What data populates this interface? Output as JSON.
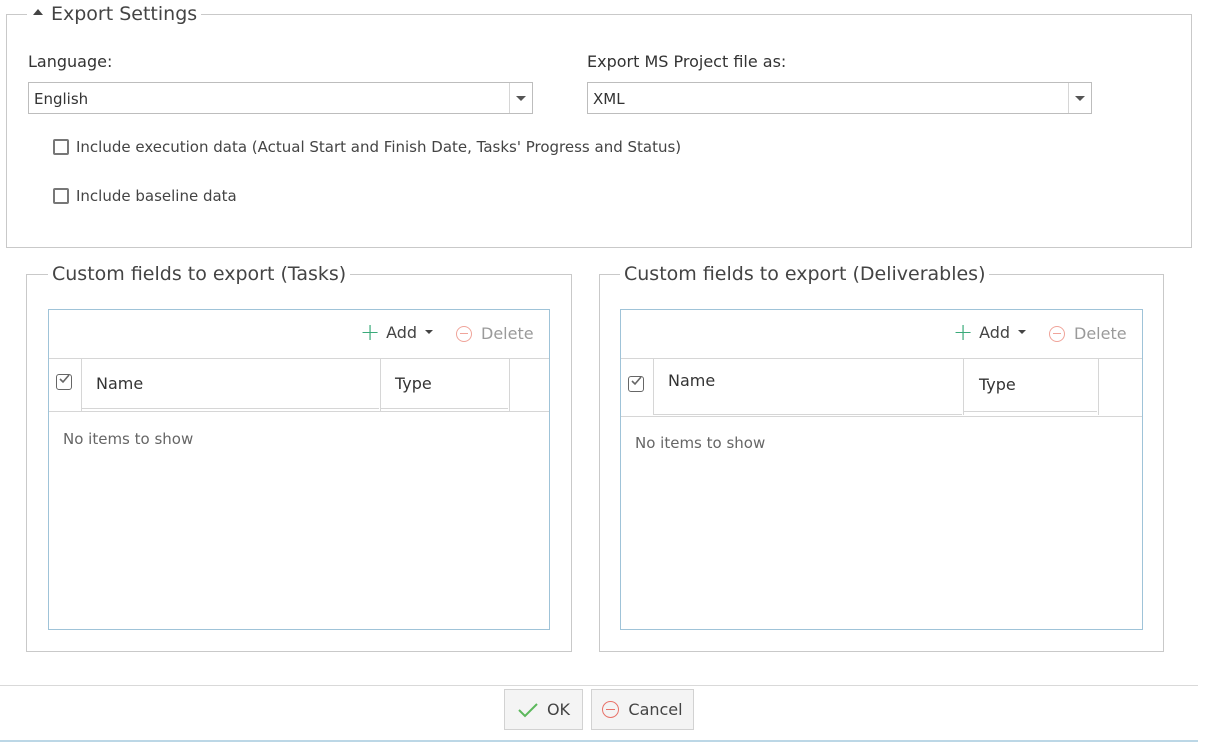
{
  "export_settings": {
    "title": "Export Settings",
    "language_label": "Language:",
    "language_value": "English",
    "ms_project_label": "Export MS Project file as:",
    "ms_project_value": "XML",
    "include_execution_label": "Include execution data (Actual Start and Finish Date, Tasks' Progress and Status)",
    "include_execution_checked": false,
    "include_baseline_label": "Include baseline data",
    "include_baseline_checked": false
  },
  "tasks_panel": {
    "title": "Custom fields to export (Tasks)",
    "add_label": "Add",
    "delete_label": "Delete",
    "columns": [
      "Name",
      "Type"
    ],
    "empty_text": "No items to show"
  },
  "deliverables_panel": {
    "title": "Custom fields to export (Deliverables)",
    "add_label": "Add",
    "delete_label": "Delete",
    "columns": [
      "Name",
      "Type"
    ],
    "empty_text": "No items to show"
  },
  "footer": {
    "ok_label": "OK",
    "cancel_label": "Cancel"
  },
  "colors": {
    "add_icon": "#3aaa7a",
    "delete_icon": "#f0a49a",
    "grid_border": "#9fc3d8",
    "ok_check": "#5cb85c",
    "cancel_icon": "#e8736a"
  }
}
